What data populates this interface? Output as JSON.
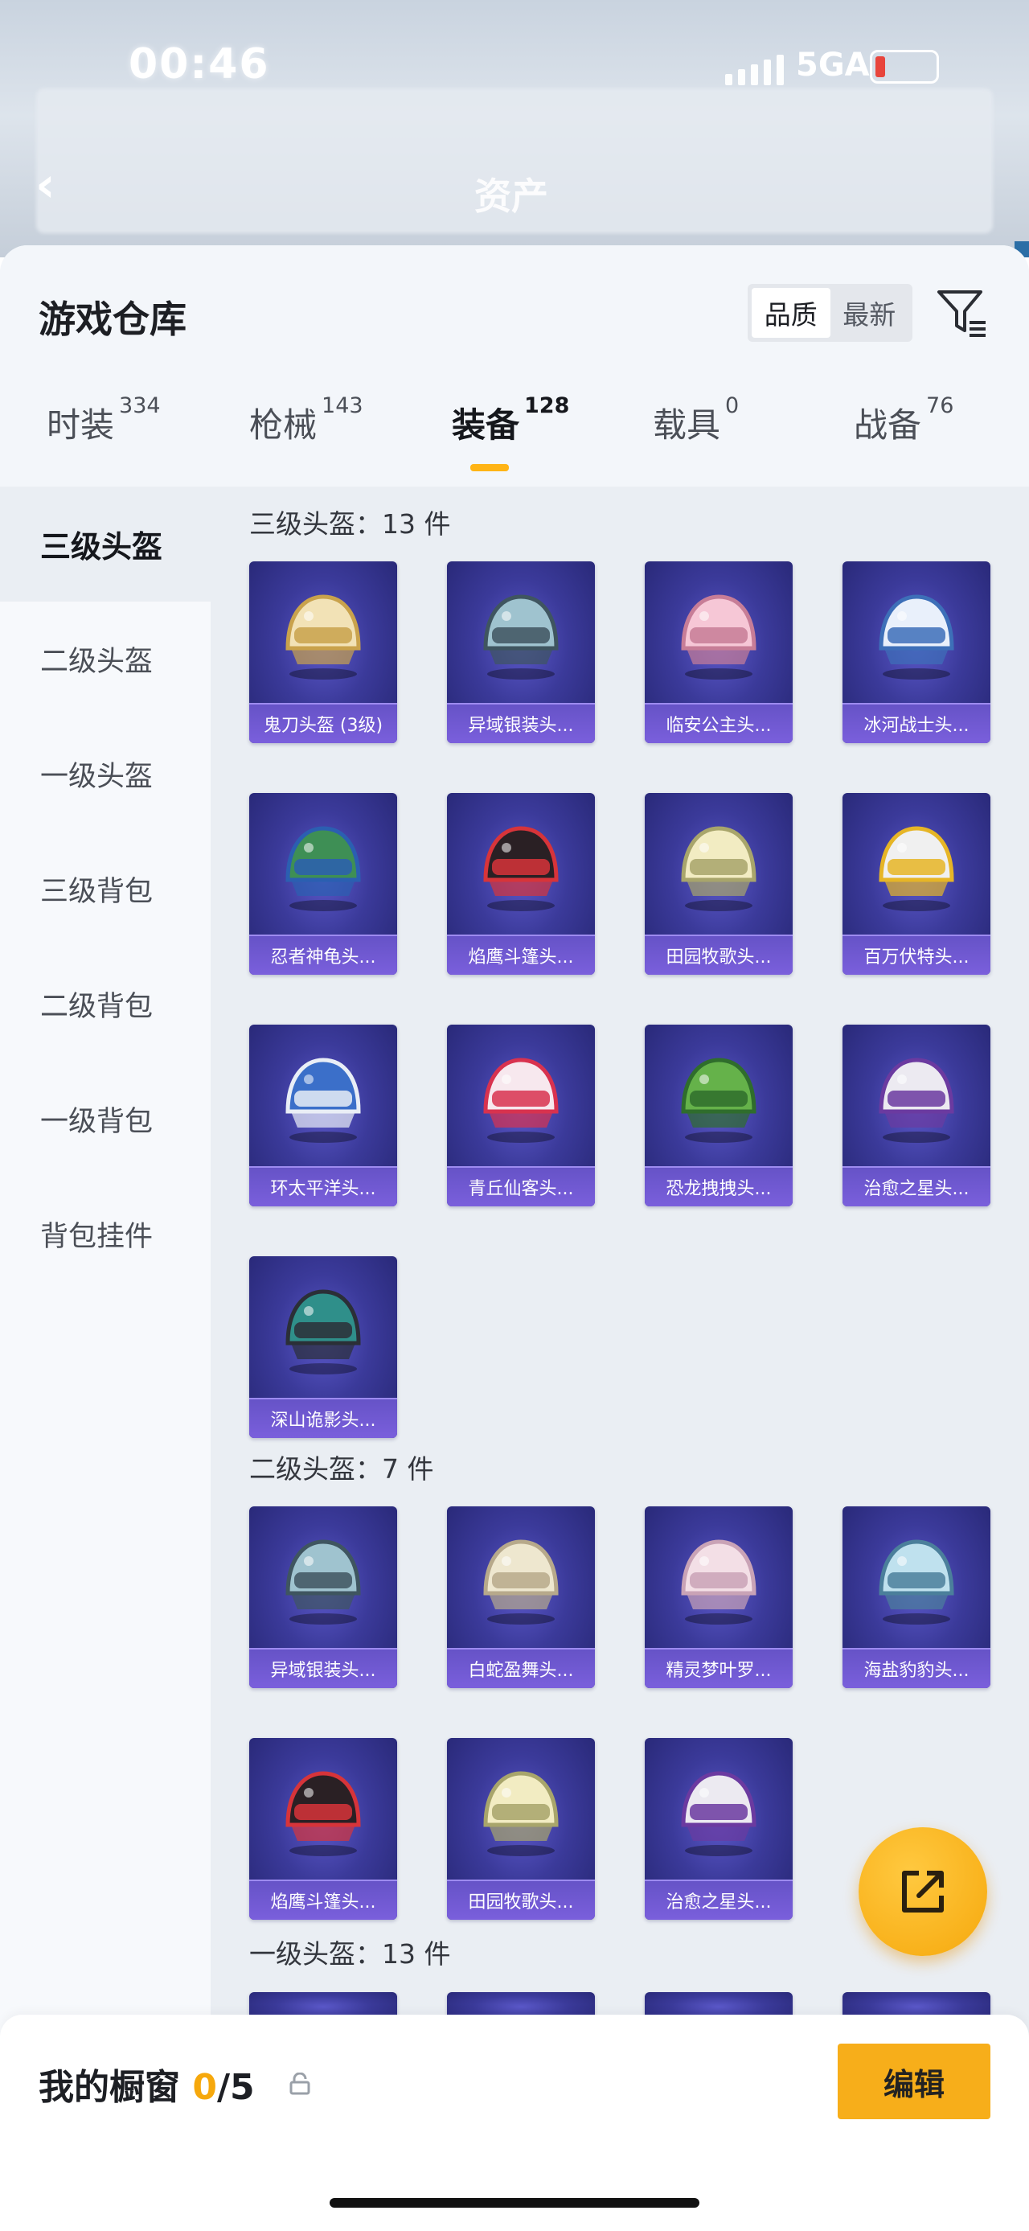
{
  "status_bar": {
    "time": "00:46",
    "network": "5GA"
  },
  "header": {
    "title": "资产"
  },
  "warehouse": {
    "title": "游戏仓库",
    "sort_options": [
      "品质",
      "最新"
    ],
    "active_sort": "品质"
  },
  "tabs": [
    {
      "label": "时装",
      "count": "334"
    },
    {
      "label": "枪械",
      "count": "143"
    },
    {
      "label": "装备",
      "count": "128",
      "active": true
    },
    {
      "label": "载具",
      "count": "0"
    },
    {
      "label": "战备",
      "count": "76"
    }
  ],
  "sidebar": {
    "items": [
      {
        "label": "三级头盔",
        "active": true
      },
      {
        "label": "二级头盔"
      },
      {
        "label": "一级头盔"
      },
      {
        "label": "三级背包"
      },
      {
        "label": "二级背包"
      },
      {
        "label": "一级背包"
      },
      {
        "label": "背包挂件"
      }
    ]
  },
  "sections": [
    {
      "heading": "三级头盔：13 件",
      "items": [
        {
          "name": "鬼刀头盔 (3级)",
          "icon": "helmet-gold-icon"
        },
        {
          "name": "异域银装头...",
          "icon": "helmet-silver-icon"
        },
        {
          "name": "临安公主头...",
          "icon": "helmet-pink-icon"
        },
        {
          "name": "冰河战士头...",
          "icon": "helmet-blue-white-icon"
        },
        {
          "name": "忍者神龟头...",
          "icon": "helmet-turtle-icon"
        },
        {
          "name": "焰鹰斗篷头...",
          "icon": "helmet-red-black-icon"
        },
        {
          "name": "田园牧歌头...",
          "icon": "helmet-flower-icon"
        },
        {
          "name": "百万伏特头...",
          "icon": "helmet-yellow-icon"
        },
        {
          "name": "环太平洋头...",
          "icon": "helmet-mecha-icon"
        },
        {
          "name": "青丘仙客头...",
          "icon": "helmet-cat-icon"
        },
        {
          "name": "恐龙拽拽头...",
          "icon": "helmet-frog-icon"
        },
        {
          "name": "治愈之星头...",
          "icon": "helmet-white-purple-icon"
        },
        {
          "name": "深山诡影头...",
          "icon": "helmet-goblin-icon"
        }
      ]
    },
    {
      "heading": "二级头盔：7 件",
      "items": [
        {
          "name": "异域银装头...",
          "icon": "helmet-silver-icon"
        },
        {
          "name": "白蛇盈舞头...",
          "icon": "helmet-cream-icon"
        },
        {
          "name": "精灵梦叶罗...",
          "icon": "helmet-pink-lace-icon"
        },
        {
          "name": "海盐豹豹头...",
          "icon": "helmet-lightblue-icon"
        },
        {
          "name": "焰鹰斗篷头...",
          "icon": "helmet-red-black-icon"
        },
        {
          "name": "田园牧歌头...",
          "icon": "helmet-flower-icon"
        },
        {
          "name": "治愈之星头...",
          "icon": "helmet-white-purple-icon"
        }
      ]
    },
    {
      "heading": "一级头盔：13 件",
      "items": []
    }
  ],
  "showcase": {
    "label": "我的橱窗",
    "current": "0",
    "total": "/5"
  },
  "edit_button": "编辑",
  "colors": {
    "accent": "#f7ae1a",
    "card_bg": "#3b3a9a",
    "name_bar": "#7a5fdc"
  }
}
